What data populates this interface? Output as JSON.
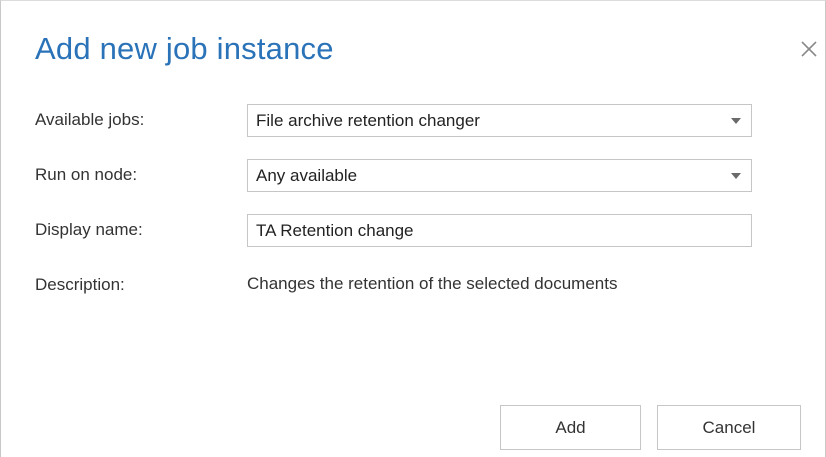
{
  "dialog": {
    "title": "Add new job instance",
    "close_icon": "close-icon"
  },
  "form": {
    "available_jobs": {
      "label": "Available jobs:",
      "value": "File archive retention changer"
    },
    "run_on_node": {
      "label": "Run on node:",
      "value": "Any available"
    },
    "display_name": {
      "label": "Display name:",
      "value": "TA Retention change"
    },
    "description": {
      "label": "Description:",
      "value": "Changes the retention of the selected documents"
    }
  },
  "buttons": {
    "add_label": "Add",
    "cancel_label": "Cancel"
  },
  "colors": {
    "title": "#2b73b8",
    "border": "#c6c6c6",
    "text": "#333333"
  }
}
